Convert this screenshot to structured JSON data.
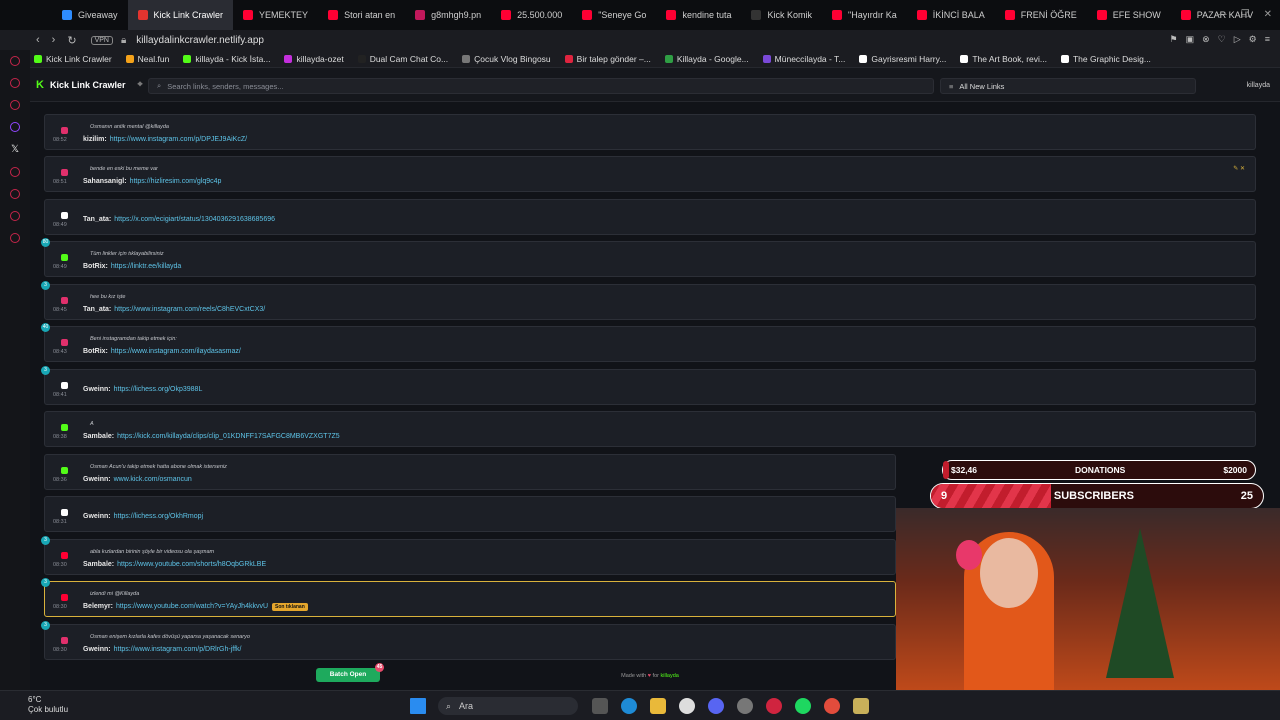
{
  "tabs": [
    "Giveaway",
    "Kick Link Crawler",
    "YEMEKTEY",
    "Stori atan en",
    "g8mhgh9.pn",
    "25.500.000",
    "\"Seneye Go",
    "kendine tuta",
    "Kick Komik",
    "\"Hayırdır Ka",
    "İKİNCİ BALA",
    "FRENİ ÖĞRE",
    "EFE SHOW",
    "PAZAR KAHV"
  ],
  "address": {
    "vpn": "VPN",
    "url": "killaydalinkcrawler.netlify.app"
  },
  "bookmarks": [
    "Kick Link Crawler",
    "Neal.fun",
    "killayda - Kick İsta...",
    "killayda-ozet",
    "Dual Cam Chat Co...",
    "Çocuk Vlog Bingosu",
    "Bir talep gönder –...",
    "Killayda - Google...",
    "Müneccilayda - T...",
    "Gayrisresmi Harry...",
    "The Art Book, revi...",
    "The Graphic Desig..."
  ],
  "app": {
    "brand": "Kick Link Crawler",
    "search_placeholder": "Search links, senders, messages...",
    "filter": "All New Links",
    "user": "killayda"
  },
  "rows": [
    {
      "time": "08:52",
      "msg": "Osmanın antik mental @killayda",
      "user": "kizilim:",
      "link": "https://www.instagram.com/p/DPJEJ9AiKcZ/",
      "badge": ""
    },
    {
      "time": "08:51",
      "msg": "bende en eski bu meme var",
      "user": "Sahansanigl:",
      "link": "https://hizliresim.com/glq9c4p",
      "badge": ""
    },
    {
      "time": "08:49",
      "msg": "",
      "user": "Tan_ata:",
      "link": "https://x.com/ecigiart/status/1304036291638685696",
      "badge": ""
    },
    {
      "time": "08:49",
      "msg": "Tüm linkler için tıklayabilirsiniz",
      "user": "BotRix:",
      "link": "https://linktr.ee/killayda",
      "badge": "80"
    },
    {
      "time": "08:45",
      "msg": "hee bu kız işte",
      "user": "Tan_ata:",
      "link": "https://www.instagram.com/reels/C8hEVCxtCX3/",
      "badge": "3"
    },
    {
      "time": "08:43",
      "msg": "Beni instagramdan takip etmek için:",
      "user": "BotRix:",
      "link": "https://www.instagram.com/ilaydasasmaz/",
      "badge": "40"
    },
    {
      "time": "08:41",
      "msg": "",
      "user": "Gweinn:",
      "link": "https://lichess.org/Okp3988L",
      "badge": "3"
    },
    {
      "time": "08:38",
      "msg": "A",
      "user": "Sambale:",
      "link": "https://kick.com/killayda/clips/clip_01KDNFF17SAFGC8MB6VZXGT7Z5",
      "badge": ""
    },
    {
      "time": "08:36",
      "msg": "Osman Acun'u takip etmek hatta abone olmak isterseniz",
      "user": "Gweinn:",
      "link": "www.kick.com/osmancun",
      "badge": ""
    },
    {
      "time": "08:31",
      "msg": "",
      "user": "Gweinn:",
      "link": "https://lichess.org/OkhRmopj",
      "badge": ""
    },
    {
      "time": "08:30",
      "msg": "abla kızlardan birinin şöyle bir videosu ola şaşmam",
      "user": "Sambale:",
      "link": "https://www.youtube.com/shorts/h8OqbGRkLBE",
      "badge": "3"
    },
    {
      "time": "08:30",
      "msg": "izlendi mi @Killayda",
      "user": "Belemyr:",
      "link": "https://www.youtube.com/watch?v=YAyJh4kkvvU",
      "badge": "3",
      "tag": "Son tıklanan"
    },
    {
      "time": "08:30",
      "msg": "Osman enişem kızlarla kafes dövüşü yaparsa yaşanacak senaryo",
      "user": "Gweinn:",
      "link": "https://www.instagram.com/p/DRlrGh-jffk/",
      "badge": "3"
    }
  ],
  "footer": {
    "prefix": "Made with",
    "suffix": "for",
    "name": "killayda",
    "batch": "Batch Open",
    "batch_count": "45"
  },
  "overlay": {
    "don_current": "$32,46",
    "don_label": "DONATIONS",
    "don_goal": "$2000",
    "don_progress": 0.016,
    "sub_current": "9",
    "sub_label": "SUBSCRIBERS",
    "sub_goal": "25",
    "sub_progress": 0.36
  },
  "taskbar": {
    "temp": "6°C",
    "weather": "Çok bulutlu",
    "search": "Ara"
  }
}
